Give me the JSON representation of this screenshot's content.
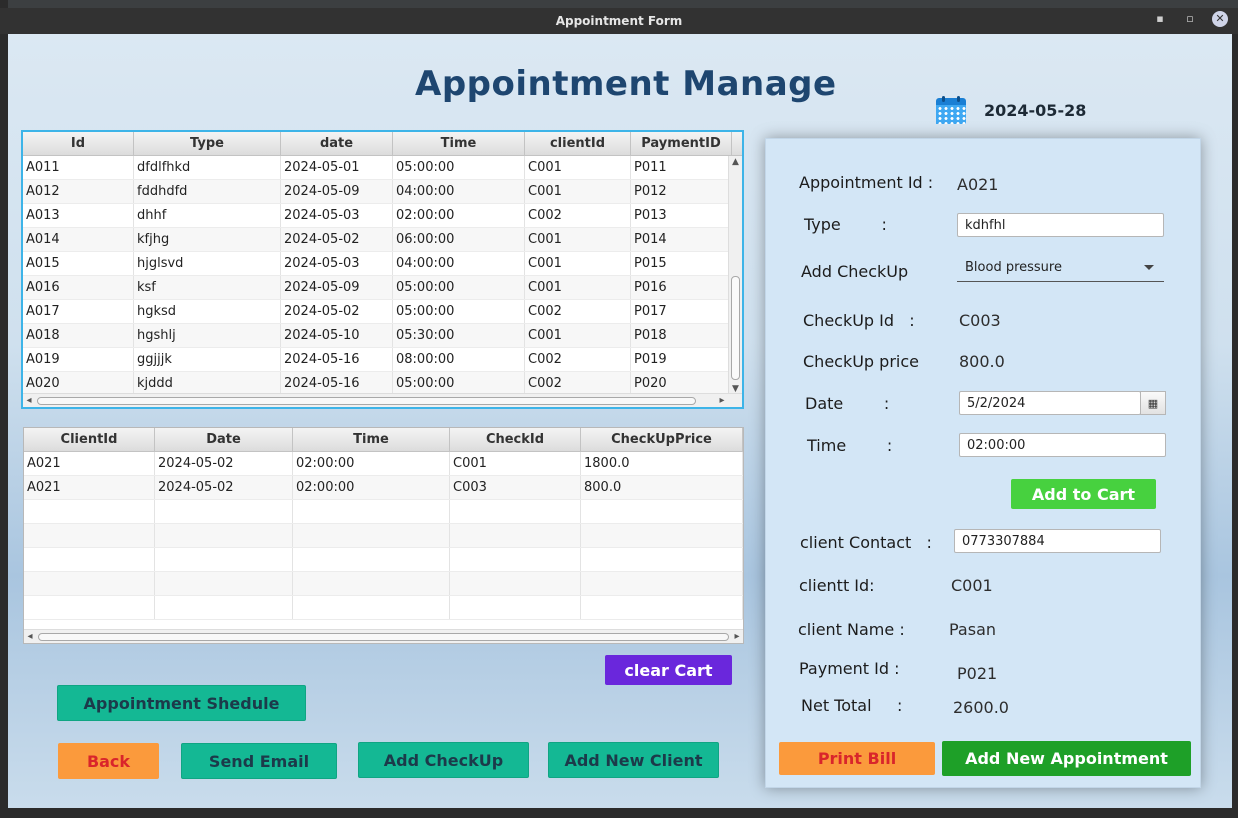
{
  "window": {
    "title": "Appointment Form"
  },
  "header": {
    "title": "Appointment Manage",
    "date": "2024-05-28"
  },
  "appointments_table": {
    "columns": [
      "Id",
      "Type",
      "date",
      "Time",
      "clientId",
      "PaymentID"
    ],
    "rows": [
      [
        "A011",
        "dfdlfhkd",
        "2024-05-01",
        "05:00:00",
        "C001",
        "P011"
      ],
      [
        "A012",
        "fddhdfd",
        "2024-05-09",
        "04:00:00",
        "C001",
        "P012"
      ],
      [
        "A013",
        "dhhf",
        "2024-05-03",
        "02:00:00",
        "C002",
        "P013"
      ],
      [
        "A014",
        "kfjhg",
        "2024-05-02",
        "06:00:00",
        "C001",
        "P014"
      ],
      [
        "A015",
        "hjglsvd",
        "2024-05-03",
        "04:00:00",
        "C001",
        "P015"
      ],
      [
        "A016",
        "ksf",
        "2024-05-09",
        "05:00:00",
        "C001",
        "P016"
      ],
      [
        "A017",
        "hgksd",
        "2024-05-02",
        "05:00:00",
        "C002",
        "P017"
      ],
      [
        "A018",
        "hgshlj",
        "2024-05-10",
        "05:30:00",
        "C001",
        "P018"
      ],
      [
        "A019",
        "ggjjjk",
        "2024-05-16",
        "08:00:00",
        "C002",
        "P019"
      ],
      [
        "A020",
        "kjddd",
        "2024-05-16",
        "05:00:00",
        "C002",
        "P020"
      ]
    ]
  },
  "cart_table": {
    "columns": [
      "ClientId",
      "Date",
      "Time",
      "CheckId",
      "CheckUpPrice"
    ],
    "rows": [
      [
        "A021",
        "2024-05-02",
        "02:00:00",
        "C001",
        "1800.0"
      ],
      [
        "A021",
        "2024-05-02",
        "02:00:00",
        "C003",
        "800.0"
      ]
    ]
  },
  "form": {
    "appointment_id_label": "Appointment Id :",
    "appointment_id_value": "A021",
    "type_label": "Type        :",
    "type_value": "kdhfhl",
    "add_checkup_label": "Add CheckUp",
    "add_checkup_value": "Blood pressure",
    "checkup_id_label": "CheckUp Id   :",
    "checkup_id_value": "C003",
    "checkup_price_label": "CheckUp price",
    "checkup_price_value": "800.0",
    "date_label": "Date        :",
    "date_value": "5/2/2024",
    "time_label": "Time        :",
    "time_value": "02:00:00",
    "add_to_cart": "Add to Cart",
    "client_contact_label": "client Contact   :",
    "client_contact_value": "0773307884",
    "client_id_label": "clientt Id:",
    "client_id_value": "C001",
    "client_name_label": "client Name :",
    "client_name_value": "Pasan",
    "payment_id_label": "Payment Id :",
    "payment_id_value": "P021",
    "net_total_label": "Net Total     :",
    "net_total_value": "2600.0",
    "print_bill": "Print Bill",
    "add_new_appointment": "Add New Appointment"
  },
  "actions": {
    "clear_cart": "clear Cart",
    "appointment_schedule": "Appointment Shedule",
    "back": "Back",
    "send_email": "Send Email",
    "add_checkup": "Add CheckUp",
    "add_new_client": "Add New Client"
  },
  "colors": {
    "title": "#1e4670",
    "teal_button": "#14b894",
    "orange_button": "#fb9a3c",
    "green_button": "#47d13f",
    "dark_green_button": "#1ea028",
    "purple_button": "#6a27dc",
    "panel": "#d3e6f6"
  }
}
